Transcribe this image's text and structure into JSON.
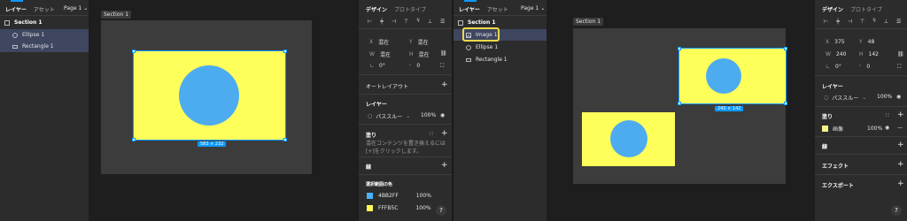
{
  "left": {
    "tabs": {
      "layers": "レイヤー",
      "assets": "アセット"
    },
    "page": "Page 1",
    "layers": [
      {
        "name": "Section 1",
        "icon": "section-icon"
      },
      {
        "name": "Ellipse 1",
        "icon": "ellipse-icon"
      },
      {
        "name": "Rectangle 1",
        "icon": "rectangle-icon"
      }
    ],
    "section_label": "Section 1",
    "size_badge": "583 × 232",
    "props": {
      "tabs": {
        "design": "デザイン",
        "prototype": "プロトタイプ"
      },
      "x_label": "X",
      "x_value": "混在",
      "y_label": "Y",
      "y_value": "混在",
      "w_label": "W",
      "w_value": "混在",
      "h_label": "H",
      "h_value": "混在",
      "rotation": "0°",
      "radius": "0",
      "auto_layout": "オートレイアウト",
      "layer_title": "レイヤー",
      "blend": "パススルー",
      "opacity": "100%",
      "fill_title": "塗り",
      "fill_note": "混在コンテンツを置き換えるには[+]をクリックします。",
      "stroke_title": "線",
      "selection_colors_title": "選択範囲の色",
      "colors": [
        {
          "hex": "4BB2FF",
          "opacity": "100%",
          "color": "#4BB2FF"
        },
        {
          "hex": "FFFB5C",
          "opacity": "100%",
          "color": "#FFFB5C"
        }
      ]
    }
  },
  "right": {
    "tabs": {
      "layers": "レイヤー",
      "assets": "アセット"
    },
    "page": "Page 1",
    "layers": [
      {
        "name": "Section 1",
        "icon": "section-icon"
      },
      {
        "name": "Image 1",
        "icon": "image-icon"
      },
      {
        "name": "Ellipse 1",
        "icon": "ellipse-icon"
      },
      {
        "name": "Rectangle 1",
        "icon": "rectangle-icon"
      }
    ],
    "section_label": "Section 1",
    "size_badge": "240 × 142",
    "props": {
      "tabs": {
        "design": "デザイン",
        "prototype": "プロトタイプ"
      },
      "x_label": "X",
      "x_value": "375",
      "y_label": "Y",
      "y_value": "48",
      "w_label": "W",
      "w_value": "240",
      "h_label": "H",
      "h_value": "142",
      "rotation": "0°",
      "radius": "0",
      "layer_title": "レイヤー",
      "blend": "パススルー",
      "opacity": "100%",
      "fill_title": "塗り",
      "fill_type": "画像",
      "fill_opacity": "100%",
      "stroke_title": "線",
      "effects_title": "エフェクト",
      "export_title": "エクスポート"
    }
  },
  "help": "?"
}
